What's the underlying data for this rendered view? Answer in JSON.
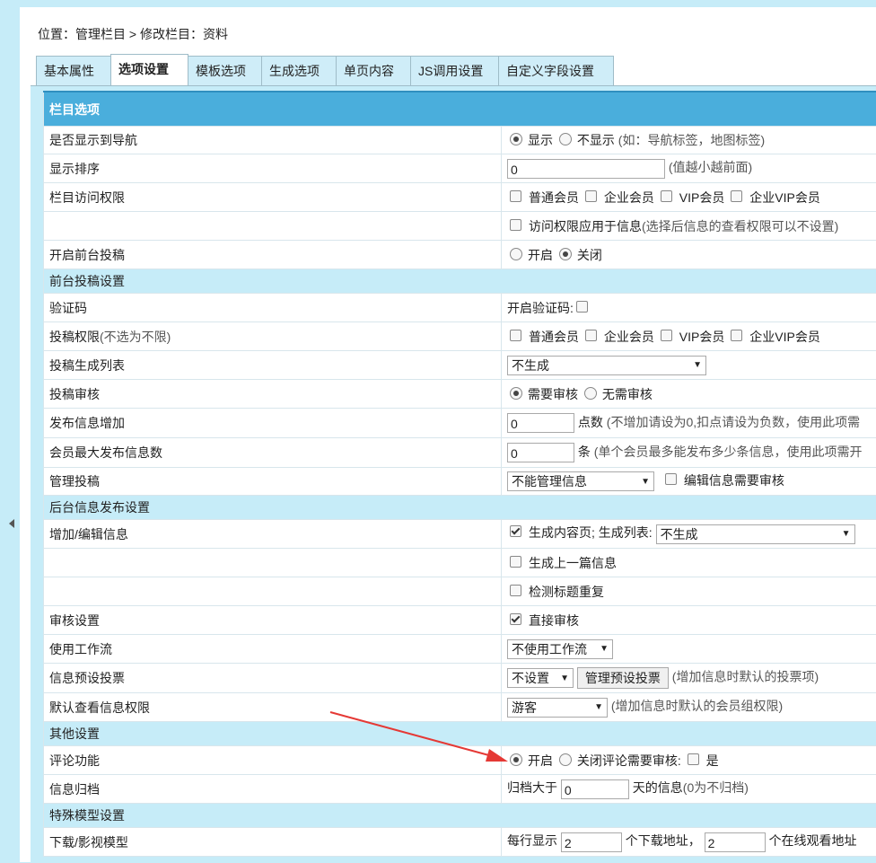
{
  "breadcrumb": {
    "prefix": "位置：",
    "path": "管理栏目 > 修改栏目：资料"
  },
  "tabs": [
    {
      "label": "基本属性"
    },
    {
      "label": "选项设置"
    },
    {
      "label": "模板选项"
    },
    {
      "label": "生成选项"
    },
    {
      "label": "单页内容"
    },
    {
      "label": "JS调用设置"
    },
    {
      "label": "自定义字段设置"
    }
  ],
  "header": "栏目选项",
  "rows": {
    "nav": {
      "label": "是否显示到导航",
      "opt_show": "显示",
      "opt_hide": "不显示",
      "hint": "(如：导航标签，地图标签)"
    },
    "order": {
      "label": "显示排序",
      "value": "0",
      "hint": "(值越小越前面)"
    },
    "access": {
      "label": "栏目访问权限",
      "opts": [
        "普通会员",
        "企业会员",
        "VIP会员",
        "企业VIP会员"
      ]
    },
    "access_apply": {
      "text": "访问权限应用于信息",
      "hint": "(选择后信息的查看权限可以不设置)"
    },
    "submit_open": {
      "label": "开启前台投稿",
      "opt_on": "开启",
      "opt_off": "关闭"
    },
    "section1": "前台投稿设置",
    "captcha": {
      "label": "验证码",
      "text": "开启验证码:"
    },
    "submit_perm": {
      "label": "投稿权限",
      "hint": "(不选为不限)",
      "opts": [
        "普通会员",
        "企业会员",
        "VIP会员",
        "企业VIP会员"
      ]
    },
    "submit_list": {
      "label": "投稿生成列表",
      "value": "不生成"
    },
    "submit_review": {
      "label": "投稿审核",
      "opt_need": "需要审核",
      "opt_none": "无需审核"
    },
    "points": {
      "label": "发布信息增加",
      "value": "0",
      "unit": "点数",
      "hint": "(不增加请设为0,扣点请设为负数，使用此项需"
    },
    "maxinfo": {
      "label": "会员最大发布信息数",
      "value": "0",
      "unit": "条",
      "hint": "(单个会员最多能发布多少条信息，使用此项需开"
    },
    "manage": {
      "label": "管理投稿",
      "value": "不能管理信息",
      "check": "编辑信息需要审核"
    },
    "section2": "后台信息发布设置",
    "add_edit": {
      "label": "增加/编辑信息",
      "check": "生成内容页;",
      "list_label": "生成列表:",
      "list_value": "不生成"
    },
    "prev": {
      "text": "生成上一篇信息"
    },
    "dup": {
      "text": "检测标题重复"
    },
    "audit": {
      "label": "审核设置",
      "text": "直接审核"
    },
    "workflow": {
      "label": "使用工作流",
      "value": "不使用工作流"
    },
    "vote": {
      "label": "信息预设投票",
      "value": "不设置",
      "button": "管理预设投票",
      "hint": "(增加信息时默认的投票项)"
    },
    "viewperm": {
      "label": "默认查看信息权限",
      "value": "游客",
      "hint": "(增加信息时默认的会员组权限)"
    },
    "section3": "其他设置",
    "comment": {
      "label": "评论功能",
      "opt_on": "开启",
      "opt_off": "关闭",
      "review": "评论需要审核:",
      "yes": "是"
    },
    "archive": {
      "label": "信息归档",
      "prefix": "归档大于",
      "value": "0",
      "suffix": "天的信息",
      "hint": "(0为不归档)"
    },
    "section4": "特殊模型设置",
    "download": {
      "label": "下载/影视模型",
      "prefix": "每行显示",
      "value1": "2",
      "mid": "个下载地址，",
      "value2": "2",
      "suffix": "个在线观看地址"
    }
  },
  "colors": {
    "header_bg": "#4aaedc",
    "section_bg": "#c6ecf8",
    "annotation": "#e53935"
  },
  "icons": {
    "collapse": "collapse-left-icon",
    "annotation": "red-arrow-annotation"
  }
}
